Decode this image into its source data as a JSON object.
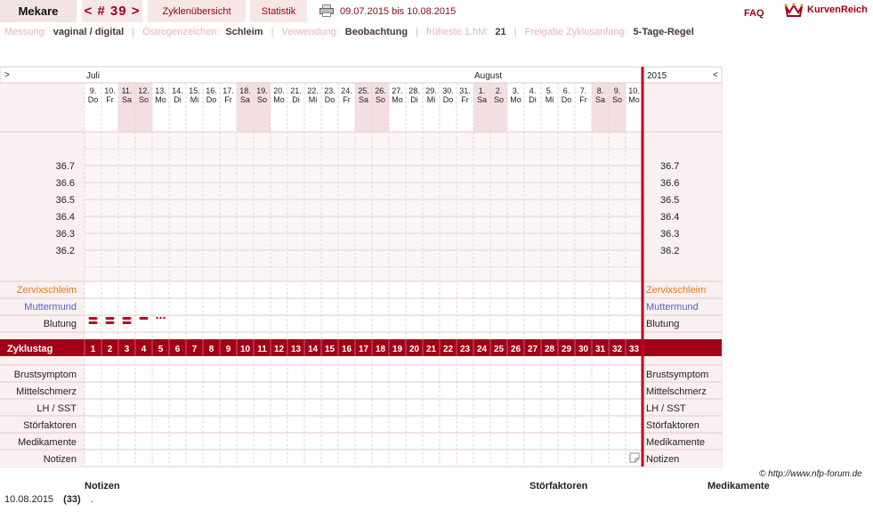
{
  "nav": {
    "user": "Mekare",
    "cycle": "< # 39 >",
    "overview": "Zyklenübersicht",
    "stats": "Statistik",
    "date_range": "09.07.2015 bis 10.08.2015",
    "faq": "FAQ",
    "logo": "KurvenReich"
  },
  "info": {
    "measure_label": "Messung:",
    "measure_value": "vaginal / digital",
    "estrogen_label": "Östrogenzeichen:",
    "estrogen_value": "Schleim",
    "usage_label": "Verwendung:",
    "usage_value": "Beobachtung",
    "earliest_label": "früheste 1.hM:",
    "earliest_value": "21",
    "release_label": "Freigabe Zyklusanfang:",
    "release_value": "5-Tage-Regel"
  },
  "chart": {
    "left_arrow": ">",
    "right_arrow": "<",
    "month1": "Juli",
    "month2": "August",
    "year": "2015",
    "days": [
      {
        "d": "9.",
        "w": "Do",
        "we": false
      },
      {
        "d": "10.",
        "w": "Fr",
        "we": false
      },
      {
        "d": "11.",
        "w": "Sa",
        "we": true
      },
      {
        "d": "12.",
        "w": "So",
        "we": true
      },
      {
        "d": "13.",
        "w": "Mo",
        "we": false
      },
      {
        "d": "14.",
        "w": "Di",
        "we": false
      },
      {
        "d": "15.",
        "w": "Mi",
        "we": false
      },
      {
        "d": "16.",
        "w": "Do",
        "we": false
      },
      {
        "d": "17.",
        "w": "Fr",
        "we": false
      },
      {
        "d": "18.",
        "w": "Sa",
        "we": true
      },
      {
        "d": "19.",
        "w": "So",
        "we": true
      },
      {
        "d": "20.",
        "w": "Mo",
        "we": false
      },
      {
        "d": "21.",
        "w": "Di",
        "we": false
      },
      {
        "d": "22.",
        "w": "Mi",
        "we": false
      },
      {
        "d": "23.",
        "w": "Do",
        "we": false
      },
      {
        "d": "24.",
        "w": "Fr",
        "we": false
      },
      {
        "d": "25.",
        "w": "Sa",
        "we": true
      },
      {
        "d": "26.",
        "w": "So",
        "we": true
      },
      {
        "d": "27.",
        "w": "Mo",
        "we": false
      },
      {
        "d": "28.",
        "w": "Di",
        "we": false
      },
      {
        "d": "29.",
        "w": "Mi",
        "we": false
      },
      {
        "d": "30.",
        "w": "Do",
        "we": false
      },
      {
        "d": "31.",
        "w": "Fr",
        "we": false
      },
      {
        "d": "1.",
        "w": "Sa",
        "we": true
      },
      {
        "d": "2.",
        "w": "So",
        "we": true
      },
      {
        "d": "3.",
        "w": "Mo",
        "we": false
      },
      {
        "d": "4.",
        "w": "Di",
        "we": false
      },
      {
        "d": "5.",
        "w": "Mi",
        "we": false
      },
      {
        "d": "6.",
        "w": "Do",
        "we": false
      },
      {
        "d": "7.",
        "w": "Fr",
        "we": false
      },
      {
        "d": "8.",
        "w": "Sa",
        "we": true
      },
      {
        "d": "9.",
        "w": "So",
        "we": true
      },
      {
        "d": "10.",
        "w": "Mo",
        "we": false
      }
    ],
    "temp_labels": [
      "36.7",
      "36.6",
      "36.5",
      "36.4",
      "36.3",
      "36.2"
    ],
    "rows_top": [
      {
        "label": "Zervixschleim",
        "color": "#e07a1f"
      },
      {
        "label": "Muttermund",
        "color": "#5a62c8"
      },
      {
        "label": "Blutung",
        "color": "#222222"
      }
    ],
    "bleeding": [
      "heavy",
      "heavy",
      "heavy",
      "medium",
      "spotting"
    ],
    "cycle_label": "Zyklustag",
    "rows_bottom": [
      "Brustsymptom",
      "Mittelschmerz",
      "LH / SST",
      "Störfaktoren",
      "Medikamente",
      "Notizen"
    ],
    "accent": "#a30019",
    "weekend_color": "#f3dfe2"
  },
  "footer": {
    "copyright": "© http://www.nfp-forum.de",
    "col_notes": "Notizen",
    "col_disturb": "Störfaktoren",
    "col_meds": "Medikamente",
    "entry_date": "10.08.2015",
    "entry_day": "(33)",
    "entry_note": "."
  }
}
